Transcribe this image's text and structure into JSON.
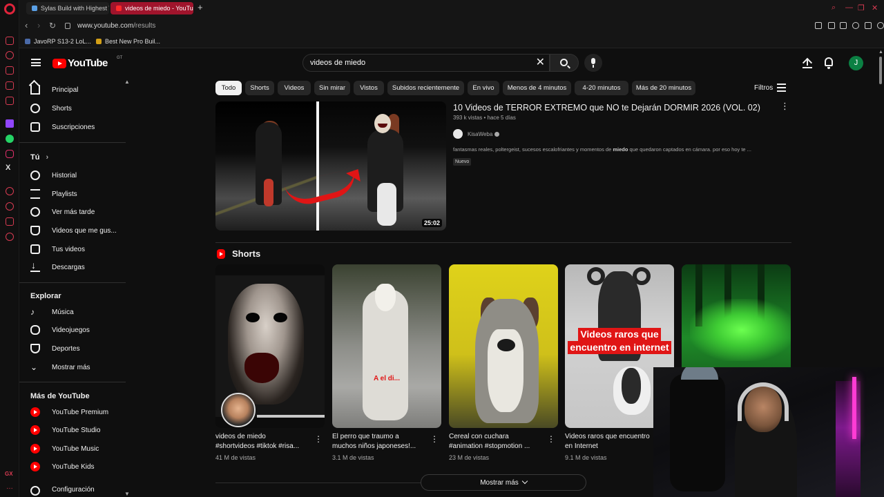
{
  "browser": {
    "tabs": [
      {
        "label": "Sylas Build with Highest W"
      },
      {
        "label": "videos de miedo - YouTube"
      }
    ],
    "url_host": "www.youtube.com",
    "url_path": "/results",
    "bookmarks": [
      {
        "label": "JavoRP S13-2 LoL..."
      },
      {
        "label": "Best New Pro Buil..."
      }
    ],
    "rail_labels": {
      "x": "X",
      "gx": "GX"
    }
  },
  "youtube": {
    "logo_text": "YouTube",
    "country_code": "GT",
    "search_value": "videos de miedo",
    "avatar_letter": "J",
    "brand_color": "#ff0000"
  },
  "sidebar": {
    "main": [
      {
        "label": "Principal",
        "icon": "home-icon"
      },
      {
        "label": "Shorts",
        "icon": "shorts-icon"
      },
      {
        "label": "Suscripciones",
        "icon": "subscriptions-icon"
      }
    ],
    "you_heading": "Tú",
    "you": [
      {
        "label": "Historial",
        "icon": "history-icon"
      },
      {
        "label": "Playlists",
        "icon": "playlists-icon"
      },
      {
        "label": "Ver más tarde",
        "icon": "clock-icon"
      },
      {
        "label": "Videos que me gus...",
        "icon": "thumbs-up-icon"
      },
      {
        "label": "Tus videos",
        "icon": "your-videos-icon"
      },
      {
        "label": "Descargas",
        "icon": "download-icon"
      }
    ],
    "explore_heading": "Explorar",
    "explore": [
      {
        "label": "Música",
        "icon": "music-icon"
      },
      {
        "label": "Videojuegos",
        "icon": "gaming-icon"
      },
      {
        "label": "Deportes",
        "icon": "trophy-icon"
      },
      {
        "label": "Mostrar más",
        "icon": "chevron-down-icon"
      }
    ],
    "more_heading": "Más de YouTube",
    "more": [
      {
        "label": "YouTube Premium"
      },
      {
        "label": "YouTube Studio"
      },
      {
        "label": "YouTube Music"
      },
      {
        "label": "YouTube Kids"
      }
    ],
    "cut_off": "Configuración"
  },
  "chips": [
    "Todo",
    "Shorts",
    "Videos",
    "Sin mirar",
    "Vistos",
    "Subidos recientemente",
    "En vivo",
    "Menos de 4 minutos",
    "4-20 minutos",
    "Más de 20 minutos"
  ],
  "filters_label": "Filtros",
  "video": {
    "title": "10 Videos de TERROR EXTREMO que NO te Dejarán DORMIR 2026 (VOL. 02)",
    "meta": "393 k vistas • hace 5 días",
    "channel": "KisaWeba",
    "description_before": "fantasmas reales, poltergeist, sucesos escalofriantes y momentos de ",
    "description_bold": "miedo",
    "description_after": " que quedaron captados en cámara. por eso hoy te ...",
    "badge": "Nuevo",
    "duration": "25:02"
  },
  "shorts_heading": "Shorts",
  "shorts": [
    {
      "title_line1": "videos de miedo",
      "title_line2": "#shortvideos #tiktok #risa...",
      "views": "41 M de vistas"
    },
    {
      "title_line1": "El perro que traumo a",
      "title_line2": "muchos niños japoneses!...",
      "views": "3.1 M de vistas",
      "overlay": "A el di..."
    },
    {
      "title_line1": "Cereal con cuchara",
      "title_line2": "#animation #stopmotion ...",
      "views": "23 M de vistas"
    },
    {
      "title_line1": "Videos raros que encuentro",
      "title_line2": "en Internet",
      "views": "9.1 M de vistas",
      "overlay_line1": "Videos raros que",
      "overlay_line2": "encuentro en internet"
    }
  ],
  "show_more_label": "Mostrar más"
}
